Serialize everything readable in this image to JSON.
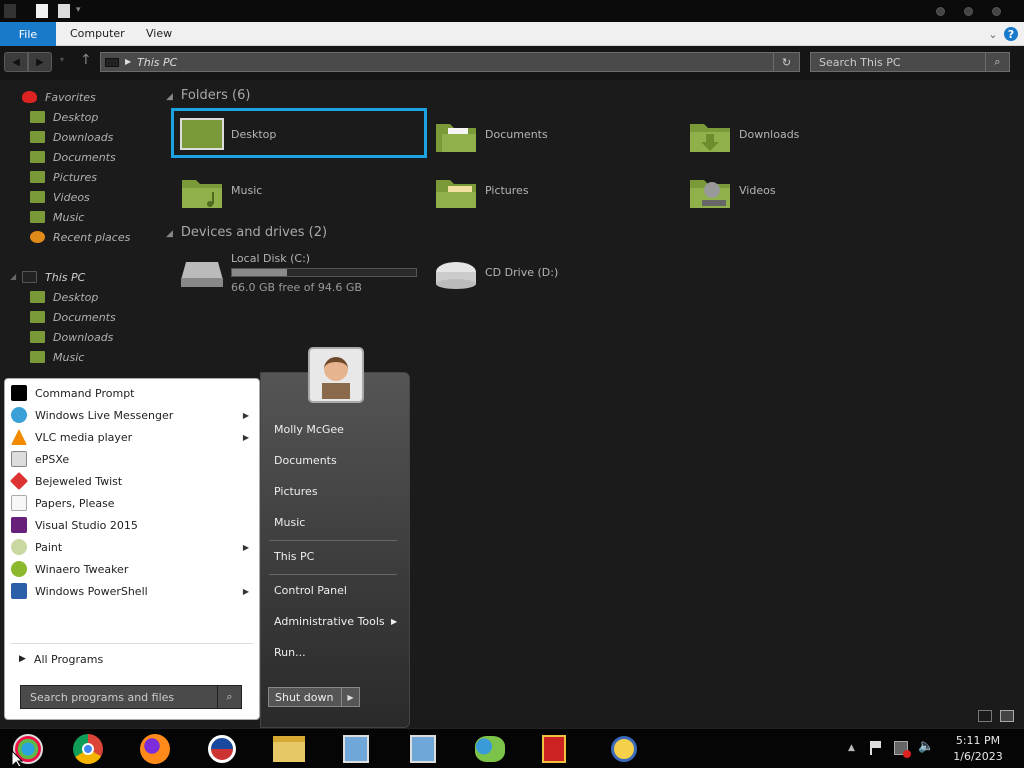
{
  "ribbon": {
    "file": "File",
    "tabs": [
      "Computer",
      "View"
    ]
  },
  "address": {
    "path": "This PC",
    "search_placeholder": "Search This PC"
  },
  "nav": {
    "favorites_label": "Favorites",
    "favorites": [
      "Desktop",
      "Downloads",
      "Documents",
      "Pictures",
      "Videos",
      "Music",
      "Recent places"
    ],
    "thispc_label": "This PC",
    "thispc": [
      "Desktop",
      "Documents",
      "Downloads",
      "Music"
    ]
  },
  "content": {
    "folders_header": "Folders (6)",
    "folders": [
      "Desktop",
      "Documents",
      "Downloads",
      "Music",
      "Pictures",
      "Videos"
    ],
    "devices_header": "Devices and drives (2)",
    "local_disk": {
      "name": "Local Disk (C:)",
      "free": "66.0 GB free of 94.6 GB",
      "used_fraction": 0.3
    },
    "cd_drive": "CD Drive (D:)"
  },
  "start_menu": {
    "programs": [
      "Command Prompt",
      "Windows Live Messenger",
      "VLC media player",
      "ePSXe",
      "Bejeweled Twist",
      "Papers, Please",
      "Visual Studio 2015",
      "Paint",
      "Winaero Tweaker",
      "Windows PowerShell"
    ],
    "all_programs": "All Programs",
    "search_placeholder": "Search programs and files",
    "user": "Molly McGee",
    "right_links": [
      "Documents",
      "Pictures",
      "Music",
      "This PC",
      "Control Panel",
      "Administrative Tools",
      "Run..."
    ],
    "shutdown": "Shut down"
  },
  "taskbar": {
    "time": "5:11 PM",
    "date": "1/6/2023"
  },
  "colors": {
    "accent": "#1979ca",
    "selection": "#1aa3e0",
    "folder_green": "#8fb04a"
  }
}
